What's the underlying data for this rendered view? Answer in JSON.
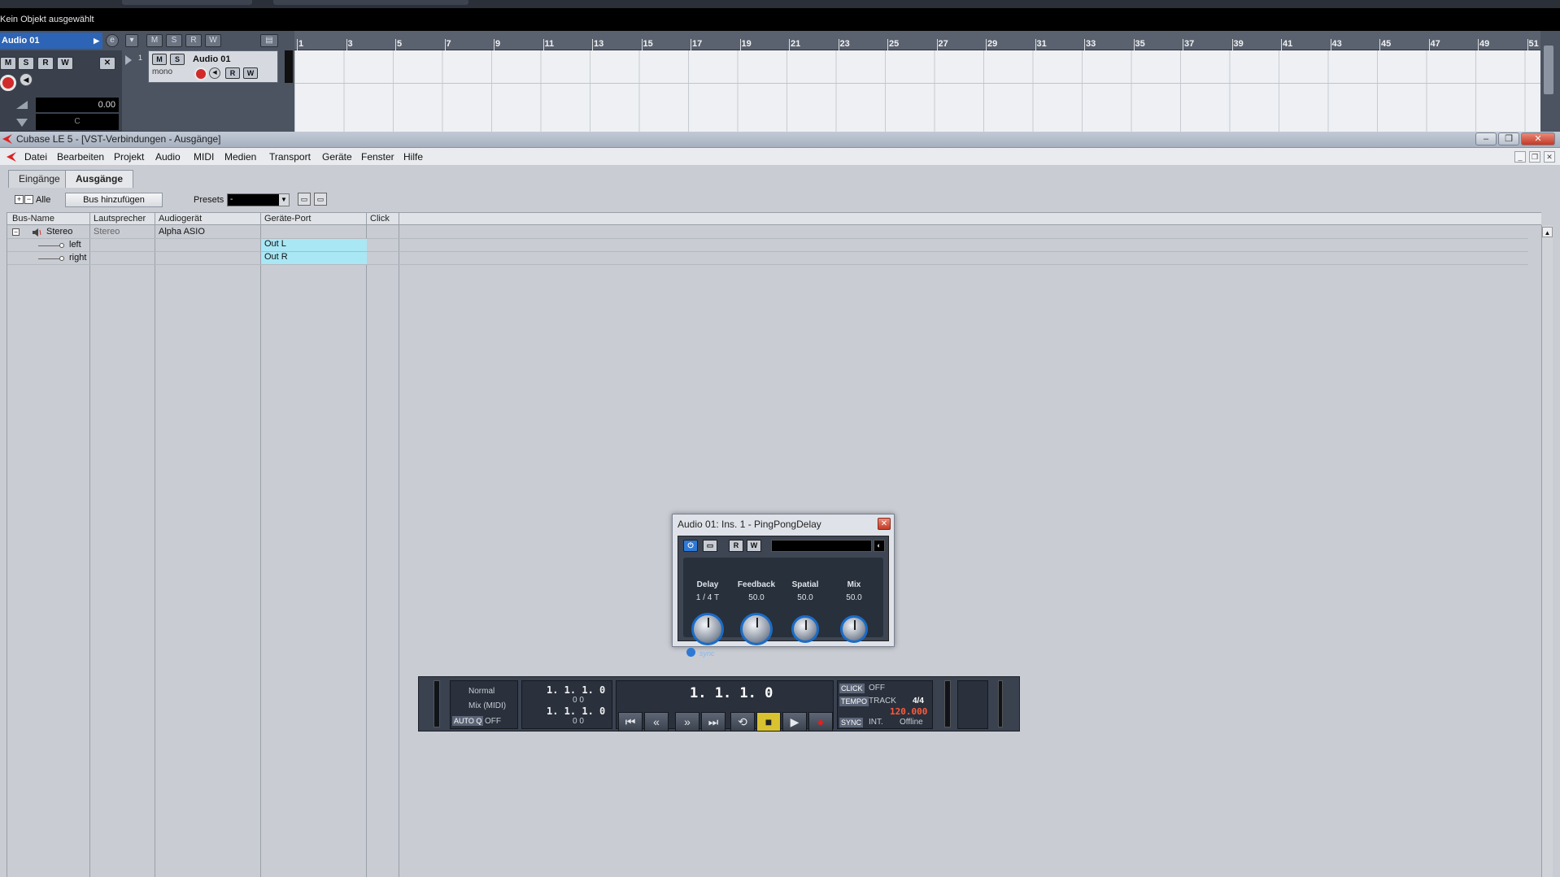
{
  "infobar": {
    "text": "Kein Objekt ausgewählt"
  },
  "track": {
    "inspector_name": "Audio 01",
    "number": "1",
    "name": "Audio 01",
    "mode": "mono",
    "volume": "0.00",
    "pan": "C",
    "buttons": {
      "m": "M",
      "s": "S",
      "r": "R",
      "w": "W"
    }
  },
  "ruler": {
    "bars": [
      "1",
      "3",
      "5",
      "7",
      "9",
      "11",
      "13",
      "15",
      "17",
      "19",
      "21",
      "23",
      "25",
      "27",
      "29",
      "31",
      "33",
      "35",
      "37",
      "39",
      "41",
      "43",
      "45",
      "47",
      "49",
      "51"
    ]
  },
  "vst_window": {
    "title": "Cubase LE 5 - [VST-Verbindungen - Ausgänge]",
    "menu": [
      "Datei",
      "Bearbeiten",
      "Projekt",
      "Audio",
      "MIDI",
      "Medien",
      "Transport",
      "Geräte",
      "Fenster",
      "Hilfe"
    ],
    "tabs": {
      "inputs": "Eingänge",
      "outputs": "Ausgänge"
    },
    "toolbar": {
      "all_label": "Alle",
      "add_bus": "Bus hinzufügen",
      "presets_label": "Presets",
      "presets_value": "-"
    },
    "columns": [
      "Bus-Name",
      "Lautsprecher",
      "Audiogerät",
      "Geräte-Port",
      "Click"
    ],
    "rows": [
      {
        "bus": "Stereo",
        "speaker": "Stereo",
        "device": "Alpha ASIO",
        "port": "",
        "click": ""
      },
      {
        "bus": "left",
        "speaker": "",
        "device": "",
        "port": "Out L",
        "click": ""
      },
      {
        "bus": "right",
        "speaker": "",
        "device": "",
        "port": "Out R",
        "click": ""
      }
    ]
  },
  "plugin": {
    "title": "Audio 01: Ins. 1 - PingPongDelay",
    "buttons": {
      "r": "R",
      "w": "W"
    },
    "params": [
      {
        "label": "Delay",
        "value": "1 / 4 T"
      },
      {
        "label": "Feedback",
        "value": "50.0"
      },
      {
        "label": "Spatial",
        "value": "50.0"
      },
      {
        "label": "Mix",
        "value": "50.0"
      }
    ],
    "sync_label": "sync"
  },
  "transport": {
    "mode": "Normal",
    "mix": "Mix (MIDI)",
    "auto_label": "AUTO Q",
    "auto_state": "OFF",
    "left_locator": "1.  1.  1.    0",
    "left_sub": "0     0",
    "right_locator": "1.  1.  1.    0",
    "right_sub": "0     0",
    "position": "1.  1.  1.    0",
    "click_tag": "CLICK",
    "click_state": "OFF",
    "tempo_tag": "TEMPO",
    "tempo_mode": "TRACK",
    "signature": "4/4",
    "tempo": "120.000",
    "sync_tag": "SYNC",
    "sync_mode": "INT.",
    "sync_state": "Offline"
  },
  "colors": {
    "accent": "#2d64b5",
    "port_highlight": "#a9e7f5",
    "record": "#d12a2a",
    "stop": "#d8c230"
  }
}
